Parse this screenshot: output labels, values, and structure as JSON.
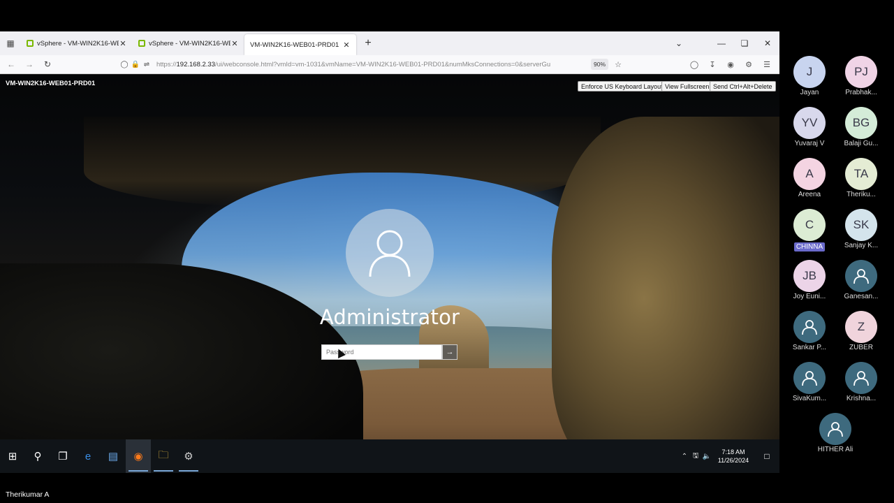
{
  "browser": {
    "tabs": [
      {
        "title": "vSphere - VM-WIN2K16-WEB0",
        "active": false
      },
      {
        "title": "vSphere - VM-WIN2K16-WEB0",
        "active": false
      },
      {
        "title": "VM-WIN2K16-WEB01-PRD01",
        "active": true
      }
    ],
    "url_host": "192.168.2.33",
    "url_prefix": "https://",
    "url_rest": "/ui/webconsole.html?vmId=vm-1031&vmName=VM-WIN2K16-WEB01-PRD01&numMksConnections=0&serverGu",
    "zoom": "90%"
  },
  "console": {
    "vm_name": "VM-WIN2K16-WEB01-PRD01",
    "buttons": {
      "keyboard": "Enforce US Keyboard Layout",
      "fullscreen": "View Fullscreen",
      "cad": "Send Ctrl+Alt+Delete"
    }
  },
  "login": {
    "user": "Administrator",
    "password_placeholder": "Password"
  },
  "taskbar": {
    "time": "7:18 AM",
    "date": "11/26/2024"
  },
  "participants": [
    {
      "initials": "J",
      "name": "Jayan",
      "color": "#c8d4ef"
    },
    {
      "initials": "PJ",
      "name": "Prabhak...",
      "color": "#f0d4e6"
    },
    {
      "initials": "YV",
      "name": "Yuvaraj V",
      "color": "#d8d8ec"
    },
    {
      "initials": "BG",
      "name": "Balaji Gu...",
      "color": "#d4ecd8"
    },
    {
      "initials": "A",
      "name": "Areena",
      "color": "#f4d4e2"
    },
    {
      "initials": "TA",
      "name": "Theriku...",
      "color": "#e4ecd4"
    },
    {
      "initials": "C",
      "name": "CHINNA",
      "color": "#dcecd4",
      "highlight": true
    },
    {
      "initials": "SK",
      "name": "Sanjay K...",
      "color": "#d4e4ec"
    },
    {
      "initials": "JB",
      "name": "Joy Euni...",
      "color": "#ecd4e8"
    },
    {
      "initials": "",
      "name": "Ganesan...",
      "color": "#3e6a7e"
    },
    {
      "initials": "",
      "name": "Sankar P...",
      "color": "#3e6a7e"
    },
    {
      "initials": "Z",
      "name": "ZUBER",
      "color": "#f0d4dc"
    },
    {
      "initials": "",
      "name": "SivaKum...",
      "color": "#3e6a7e"
    },
    {
      "initials": "",
      "name": "Krishna...",
      "color": "#3e6a7e"
    },
    {
      "initials": "",
      "name": "HITHER Ali",
      "color": "#3e6a7e"
    }
  ],
  "presenter": "Therikumar A"
}
